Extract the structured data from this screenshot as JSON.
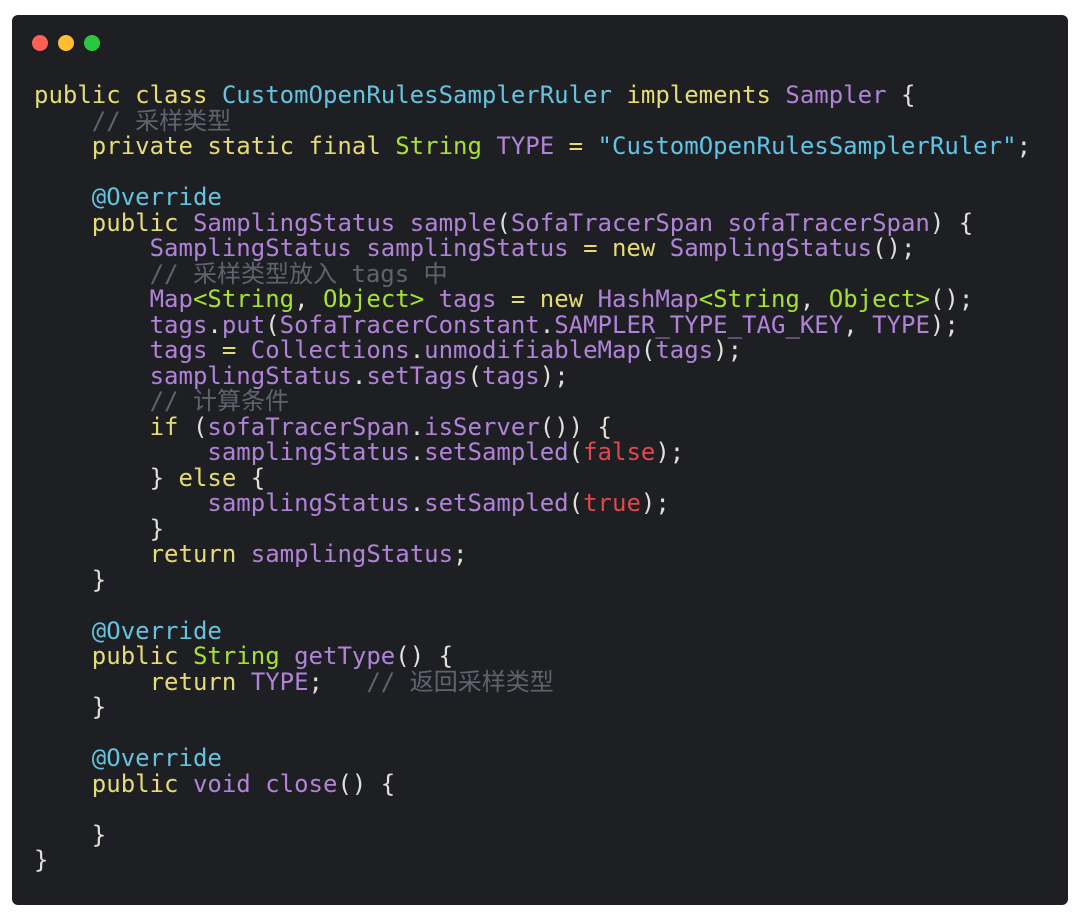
{
  "window": {
    "dots": [
      {
        "name": "close",
        "color": "#fe5f57"
      },
      {
        "name": "minimize",
        "color": "#febc2e"
      },
      {
        "name": "zoom",
        "color": "#28c840"
      }
    ]
  },
  "code": {
    "lines": [
      [
        [
          "kw",
          "public class "
        ],
        [
          "cls",
          "CustomOpenRulesSamplerRuler "
        ],
        [
          "kw",
          "implements "
        ],
        [
          "pur",
          "Sampler "
        ],
        [
          "punc",
          "{"
        ]
      ],
      [
        [
          "punc",
          "    "
        ],
        [
          "cmt",
          "// 采样类型"
        ]
      ],
      [
        [
          "punc",
          "    "
        ],
        [
          "kw",
          "private static final "
        ],
        [
          "typ",
          "String "
        ],
        [
          "pur",
          "TYPE "
        ],
        [
          "kw",
          "= "
        ],
        [
          "str",
          "\"CustomOpenRulesSamplerRuler\""
        ],
        [
          "punc",
          ";"
        ]
      ],
      [
        [
          "punc",
          ""
        ]
      ],
      [
        [
          "punc",
          "    "
        ],
        [
          "ann",
          "@Override"
        ]
      ],
      [
        [
          "punc",
          "    "
        ],
        [
          "kw",
          "public "
        ],
        [
          "pur",
          "SamplingStatus sample"
        ],
        [
          "punc",
          "("
        ],
        [
          "pur",
          "SofaTracerSpan sofaTracerSpan"
        ],
        [
          "punc",
          ") {"
        ]
      ],
      [
        [
          "punc",
          "        "
        ],
        [
          "pur",
          "SamplingStatus samplingStatus "
        ],
        [
          "kw",
          "= new "
        ],
        [
          "pur",
          "SamplingStatus"
        ],
        [
          "punc",
          "();"
        ]
      ],
      [
        [
          "punc",
          "        "
        ],
        [
          "cmt",
          "// 采样类型放入 tags 中"
        ]
      ],
      [
        [
          "punc",
          "        "
        ],
        [
          "pur",
          "Map"
        ],
        [
          "typ",
          "<String"
        ],
        [
          "punc",
          ", "
        ],
        [
          "typ",
          "Object> "
        ],
        [
          "pur",
          "tags "
        ],
        [
          "kw",
          "= new "
        ],
        [
          "pur",
          "HashMap"
        ],
        [
          "typ",
          "<String"
        ],
        [
          "punc",
          ", "
        ],
        [
          "typ",
          "Object>"
        ],
        [
          "punc",
          "();"
        ]
      ],
      [
        [
          "punc",
          "        "
        ],
        [
          "pur",
          "tags"
        ],
        [
          "punc",
          "."
        ],
        [
          "pur",
          "put"
        ],
        [
          "punc",
          "("
        ],
        [
          "pur",
          "SofaTracerConstant"
        ],
        [
          "punc",
          "."
        ],
        [
          "pur",
          "SAMPLER_TYPE_TAG_KEY"
        ],
        [
          "punc",
          ", "
        ],
        [
          "pur",
          "TYPE"
        ],
        [
          "punc",
          ");"
        ]
      ],
      [
        [
          "punc",
          "        "
        ],
        [
          "pur",
          "tags "
        ],
        [
          "kw",
          "= "
        ],
        [
          "pur",
          "Collections"
        ],
        [
          "punc",
          "."
        ],
        [
          "pur",
          "unmodifiableMap"
        ],
        [
          "punc",
          "("
        ],
        [
          "pur",
          "tags"
        ],
        [
          "punc",
          ");"
        ]
      ],
      [
        [
          "punc",
          "        "
        ],
        [
          "pur",
          "samplingStatus"
        ],
        [
          "punc",
          "."
        ],
        [
          "pur",
          "setTags"
        ],
        [
          "punc",
          "("
        ],
        [
          "pur",
          "tags"
        ],
        [
          "punc",
          ");"
        ]
      ],
      [
        [
          "punc",
          "        "
        ],
        [
          "cmt",
          "// 计算条件"
        ]
      ],
      [
        [
          "punc",
          "        "
        ],
        [
          "kw",
          "if "
        ],
        [
          "punc",
          "("
        ],
        [
          "pur",
          "sofaTracerSpan"
        ],
        [
          "punc",
          "."
        ],
        [
          "pur",
          "isServer"
        ],
        [
          "punc",
          "()) {"
        ]
      ],
      [
        [
          "punc",
          "            "
        ],
        [
          "pur",
          "samplingStatus"
        ],
        [
          "punc",
          "."
        ],
        [
          "pur",
          "setSampled"
        ],
        [
          "punc",
          "("
        ],
        [
          "bool",
          "false"
        ],
        [
          "punc",
          ");"
        ]
      ],
      [
        [
          "punc",
          "        } "
        ],
        [
          "kw",
          "else "
        ],
        [
          "punc",
          "{"
        ]
      ],
      [
        [
          "punc",
          "            "
        ],
        [
          "pur",
          "samplingStatus"
        ],
        [
          "punc",
          "."
        ],
        [
          "pur",
          "setSampled"
        ],
        [
          "punc",
          "("
        ],
        [
          "bool",
          "true"
        ],
        [
          "punc",
          ");"
        ]
      ],
      [
        [
          "punc",
          "        }"
        ]
      ],
      [
        [
          "punc",
          "        "
        ],
        [
          "kw",
          "return "
        ],
        [
          "pur",
          "samplingStatus"
        ],
        [
          "punc",
          ";"
        ]
      ],
      [
        [
          "punc",
          "    }"
        ]
      ],
      [
        [
          "punc",
          ""
        ]
      ],
      [
        [
          "punc",
          "    "
        ],
        [
          "ann",
          "@Override"
        ]
      ],
      [
        [
          "punc",
          "    "
        ],
        [
          "kw",
          "public "
        ],
        [
          "typ",
          "String "
        ],
        [
          "pur",
          "getType"
        ],
        [
          "punc",
          "() {"
        ]
      ],
      [
        [
          "punc",
          "        "
        ],
        [
          "kw",
          "return "
        ],
        [
          "pur",
          "TYPE"
        ],
        [
          "punc",
          ";   "
        ],
        [
          "cmt",
          "// 返回采样类型"
        ]
      ],
      [
        [
          "punc",
          "    }"
        ]
      ],
      [
        [
          "punc",
          ""
        ]
      ],
      [
        [
          "punc",
          "    "
        ],
        [
          "ann",
          "@Override"
        ]
      ],
      [
        [
          "punc",
          "    "
        ],
        [
          "kw",
          "public "
        ],
        [
          "pur",
          "void close"
        ],
        [
          "punc",
          "() {"
        ]
      ],
      [
        [
          "punc",
          ""
        ]
      ],
      [
        [
          "punc",
          "    }"
        ]
      ],
      [
        [
          "punc",
          "}"
        ]
      ]
    ]
  }
}
